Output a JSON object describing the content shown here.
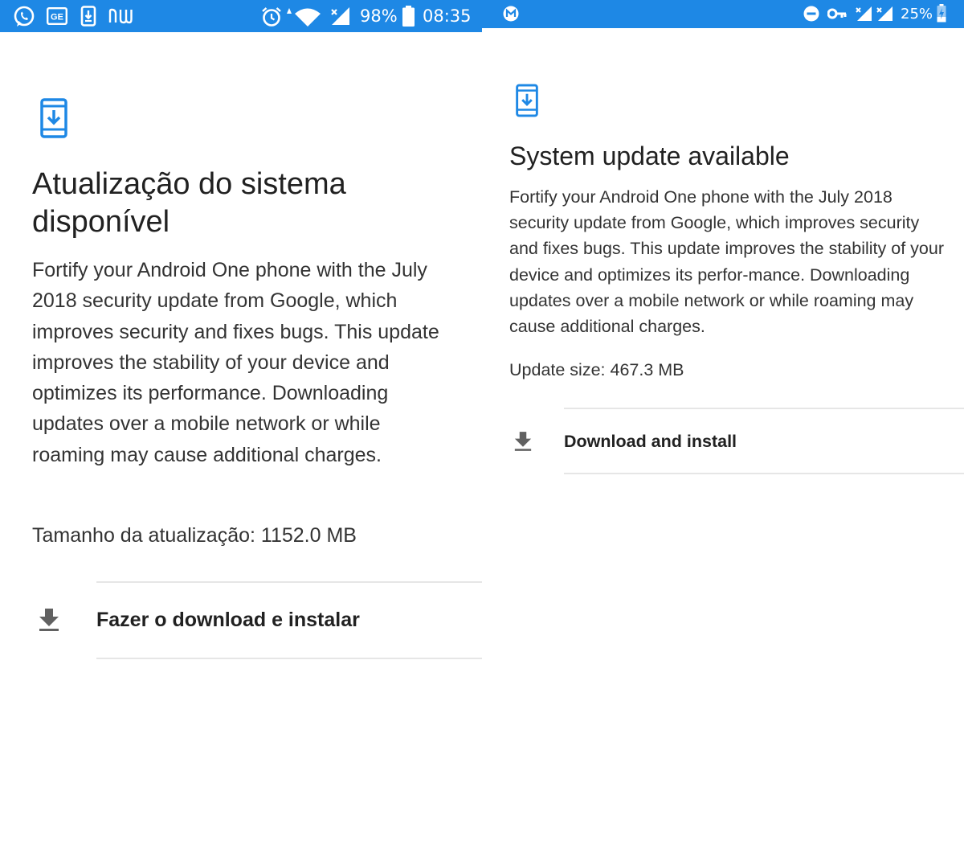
{
  "colors": {
    "status_bar": "#1e88e5",
    "accent_icon": "#1e88e5",
    "text_primary": "#212121",
    "text_body": "#333333",
    "divider": "#e6e6e6",
    "download_icon": "#616161"
  },
  "left_screen": {
    "status_bar": {
      "left_icons": [
        "whatsapp-icon",
        "ge-news-icon",
        "download-notification-icon",
        "nubank-icon"
      ],
      "right_icons": [
        "alarm-icon",
        "wifi-icon",
        "signal-icon",
        "battery-icon"
      ],
      "battery": "98%",
      "time": "08:35"
    },
    "app_icon": "system-update-icon",
    "title": "Atualização do sistema disponível",
    "description": "Fortify your Android One phone with the July 2018 security update from Google, which improves security and fixes bugs. This update improves the stability of your device and optimizes its performance. Downloading updates over a mobile network or while roaming may cause additional charges.",
    "update_size": "Tamanho da atualização: 1152.0 MB",
    "download_button": {
      "icon": "download-icon",
      "label": "Fazer o download e instalar"
    }
  },
  "right_screen": {
    "status_bar": {
      "left_icons": [
        "gmail-icon"
      ],
      "right_icons": [
        "do-not-disturb-icon",
        "vpn-key-icon",
        "signal-icon",
        "signal-icon",
        "battery-icon"
      ],
      "battery": "25%"
    },
    "app_icon": "system-update-icon",
    "title": "System update available",
    "description": "Fortify your Android One phone with the July 2018 security update from Google, which improves security and fixes bugs. This update improves the stability of your device and optimizes its perfor-mance. Downloading updates over a mobile network or while roaming may cause additional charges.",
    "update_size": "Update size: 467.3 MB",
    "download_button": {
      "icon": "download-icon",
      "label": "Download and install"
    }
  }
}
